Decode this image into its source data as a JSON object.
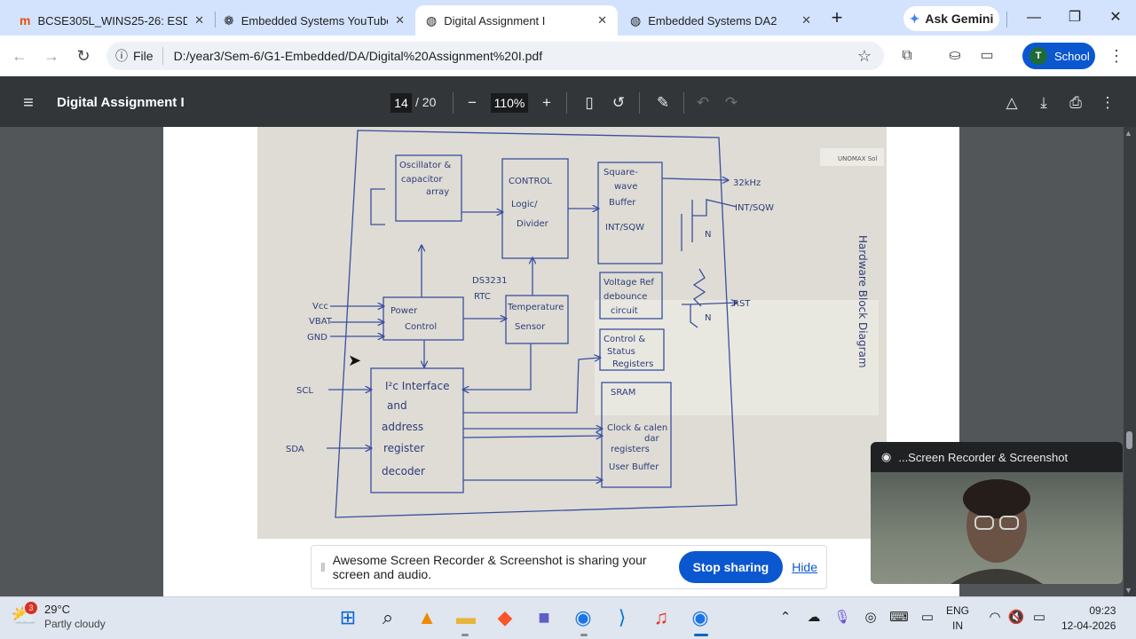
{
  "tabs": [
    {
      "title": "BCSE305L_WINS25-26: ESD A...",
      "icon": "moodle-icon",
      "active": false
    },
    {
      "title": "Embedded Systems YouTube",
      "icon": "openai-icon",
      "active": false
    },
    {
      "title": "Digital Assignment I",
      "icon": "globe-icon",
      "active": true
    },
    {
      "title": "Embedded Systems DA2",
      "icon": "globe-icon",
      "active": false
    }
  ],
  "gemini_label": "Ask Gemini",
  "address": {
    "scheme_label": "File",
    "url": "D:/year3/Sem-6/G1-Embedded/DA/Digital%20Assignment%20I.pdf"
  },
  "profile": {
    "initial": "T",
    "label": "School"
  },
  "pdf": {
    "title": "Digital Assignment I",
    "page_current": "14",
    "page_total": "/ 20",
    "zoom": "110%"
  },
  "diagram": {
    "blocks": {
      "osc": [
        "Oscillator &",
        "capacitor",
        "array"
      ],
      "control_logic": [
        "CONTROL",
        "Logic/",
        "Divider"
      ],
      "square_wave": [
        "Square-",
        "wave",
        "Buffer",
        "INT/SQW"
      ],
      "power_control": [
        "Power",
        "Control"
      ],
      "temp_sensor": [
        "Temperature",
        "Sensor"
      ],
      "vref": [
        "Voltage Ref",
        "debounce",
        "circuit"
      ],
      "ctrl_status": [
        "Control &",
        "Status",
        "Registers"
      ],
      "i2c": [
        "I²c Interface",
        "and",
        "address",
        "register",
        "decoder"
      ],
      "sram": [
        "SRAM",
        "Clock & calen",
        "dar",
        "registers",
        "User Buffer"
      ]
    },
    "pins": {
      "vcc": "Vcc",
      "vbat": "VBAT",
      "gnd": "GND",
      "scl": "SCL",
      "sda": "SDA",
      "out32": "32kHz",
      "int_sqw": "INT/SQW",
      "rst": "RST",
      "n1": "N",
      "n2": "N"
    },
    "chip_label": [
      "DS3231",
      "RTC"
    ],
    "side_label": "Hardware Block Diagram",
    "sticker": "UNOMAX Sol"
  },
  "share_bar": {
    "message": "Awesome Screen Recorder & Screenshot is sharing your screen and audio.",
    "stop_label": "Stop sharing",
    "hide_label": "Hide"
  },
  "recorder_title": "...Screen Recorder & Screenshot",
  "weather": {
    "badge": "3",
    "temp": "29°C",
    "desc": "Partly cloudy"
  },
  "language": {
    "line1": "ENG",
    "line2": "IN"
  },
  "clock": {
    "time": "09:23",
    "date": "12-04-2026"
  }
}
